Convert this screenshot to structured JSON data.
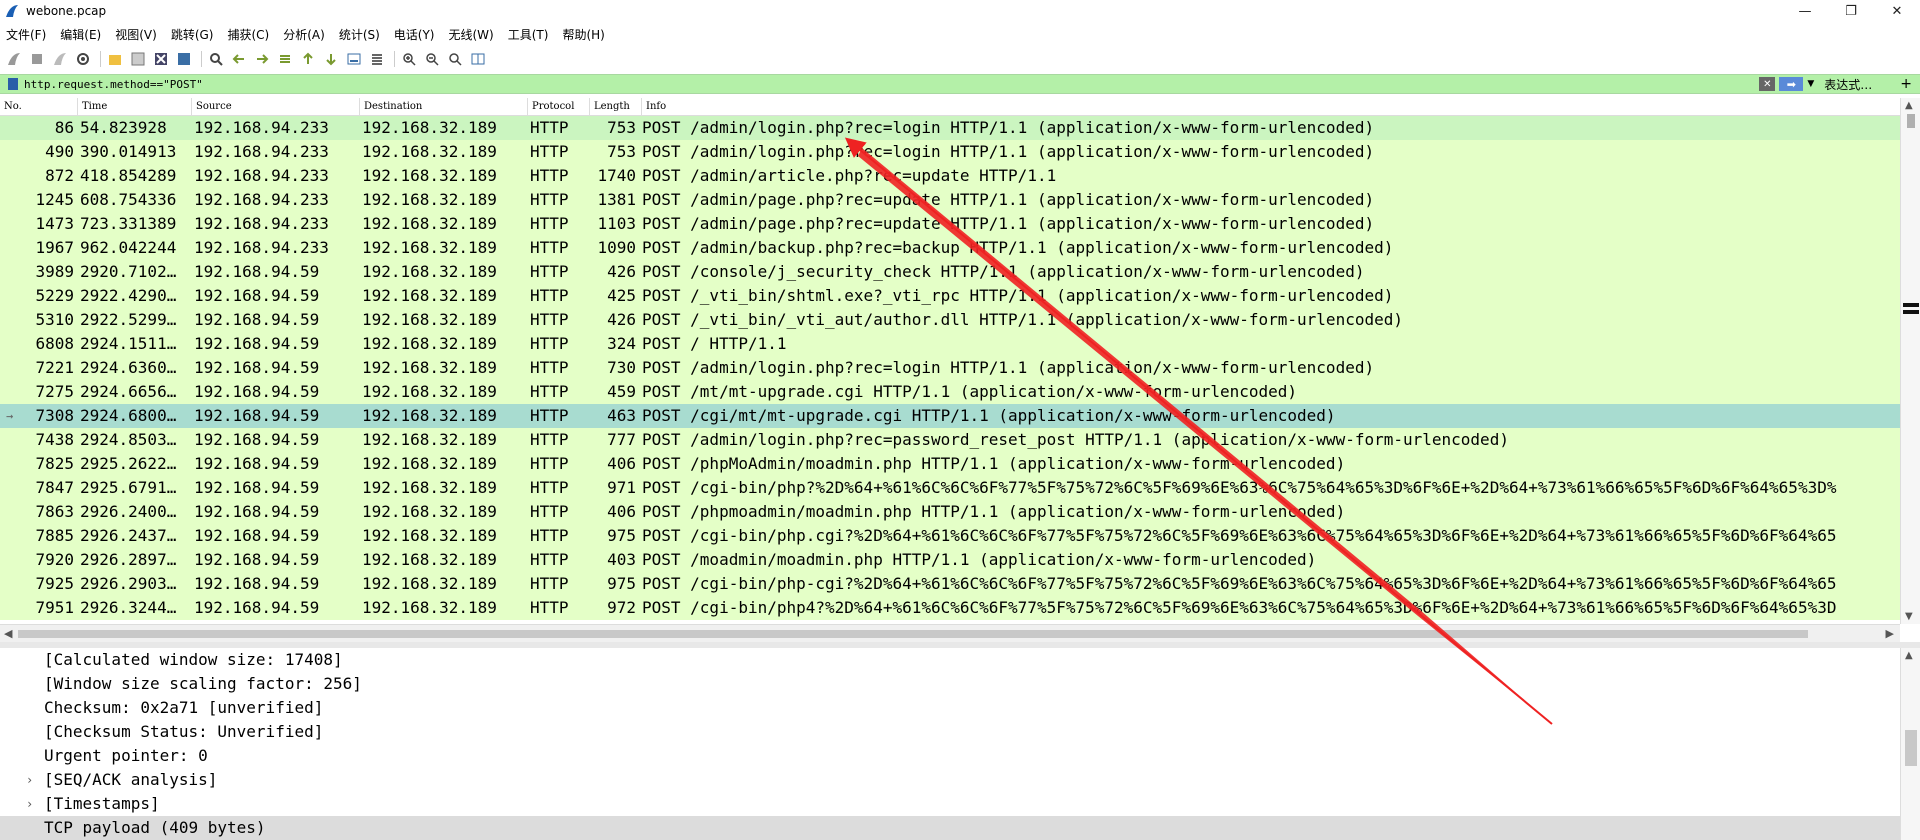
{
  "window": {
    "title": "webone.pcap",
    "controls": {
      "minimize": "—",
      "maximize": "❐",
      "close": "✕"
    }
  },
  "menu": [
    "文件(F)",
    "编辑(E)",
    "视图(V)",
    "跳转(G)",
    "捕获(C)",
    "分析(A)",
    "统计(S)",
    "电话(Y)",
    "无线(W)",
    "工具(T)",
    "帮助(H)"
  ],
  "toolbar": {
    "icons": [
      "shark-start-icon",
      "stop-icon",
      "restart-icon",
      "options-icon",
      "open-icon",
      "save-icon",
      "close-file-icon",
      "reload-icon",
      "find-icon",
      "back-icon",
      "forward-icon",
      "goto-icon",
      "first-icon",
      "last-icon",
      "autoscroll-icon",
      "colorize-icon",
      "zoom-in-icon",
      "zoom-out-icon",
      "zoom-reset-icon",
      "resize-columns-icon"
    ]
  },
  "filter": {
    "value": "http.request.method==\"POST\"",
    "expression_label": "表达式…",
    "add_label": "+"
  },
  "columns": [
    "No.",
    "Time",
    "Source",
    "Destination",
    "Protocol",
    "Length",
    "Info"
  ],
  "packets": [
    {
      "no": "86",
      "time": "54.823928",
      "src": "192.168.94.233",
      "dst": "192.168.32.189",
      "proto": "HTTP",
      "len": "753",
      "info": "POST /admin/login.php?rec=login HTTP/1.1  (application/x-www-form-urlencoded)"
    },
    {
      "no": "490",
      "time": "390.014913",
      "src": "192.168.94.233",
      "dst": "192.168.32.189",
      "proto": "HTTP",
      "len": "753",
      "info": "POST /admin/login.php?rec=login HTTP/1.1  (application/x-www-form-urlencoded)"
    },
    {
      "no": "872",
      "time": "418.854289",
      "src": "192.168.94.233",
      "dst": "192.168.32.189",
      "proto": "HTTP",
      "len": "1740",
      "info": "POST /admin/article.php?rec=update HTTP/1.1"
    },
    {
      "no": "1245",
      "time": "608.754336",
      "src": "192.168.94.233",
      "dst": "192.168.32.189",
      "proto": "HTTP",
      "len": "1381",
      "info": "POST /admin/page.php?rec=update HTTP/1.1  (application/x-www-form-urlencoded)"
    },
    {
      "no": "1473",
      "time": "723.331389",
      "src": "192.168.94.233",
      "dst": "192.168.32.189",
      "proto": "HTTP",
      "len": "1103",
      "info": "POST /admin/page.php?rec=update HTTP/1.1  (application/x-www-form-urlencoded)"
    },
    {
      "no": "1967",
      "time": "962.042244",
      "src": "192.168.94.233",
      "dst": "192.168.32.189",
      "proto": "HTTP",
      "len": "1090",
      "info": "POST /admin/backup.php?rec=backup HTTP/1.1  (application/x-www-form-urlencoded)"
    },
    {
      "no": "3989",
      "time": "2920.7102…",
      "src": "192.168.94.59",
      "dst": "192.168.32.189",
      "proto": "HTTP",
      "len": "426",
      "info": "POST /console/j_security_check HTTP/1.1  (application/x-www-form-urlencoded)"
    },
    {
      "no": "5229",
      "time": "2922.4290…",
      "src": "192.168.94.59",
      "dst": "192.168.32.189",
      "proto": "HTTP",
      "len": "425",
      "info": "POST /_vti_bin/shtml.exe?_vti_rpc HTTP/1.1  (application/x-www-form-urlencoded)"
    },
    {
      "no": "5310",
      "time": "2922.5299…",
      "src": "192.168.94.59",
      "dst": "192.168.32.189",
      "proto": "HTTP",
      "len": "426",
      "info": "POST /_vti_bin/_vti_aut/author.dll HTTP/1.1  (application/x-www-form-urlencoded)"
    },
    {
      "no": "6808",
      "time": "2924.1511…",
      "src": "192.168.94.59",
      "dst": "192.168.32.189",
      "proto": "HTTP",
      "len": "324",
      "info": "POST / HTTP/1.1"
    },
    {
      "no": "7221",
      "time": "2924.6360…",
      "src": "192.168.94.59",
      "dst": "192.168.32.189",
      "proto": "HTTP",
      "len": "730",
      "info": "POST /admin/login.php?rec=login HTTP/1.1  (application/x-www-form-urlencoded)"
    },
    {
      "no": "7275",
      "time": "2924.6656…",
      "src": "192.168.94.59",
      "dst": "192.168.32.189",
      "proto": "HTTP",
      "len": "459",
      "info": "POST /mt/mt-upgrade.cgi HTTP/1.1  (application/x-www-form-urlencoded)"
    },
    {
      "no": "7308",
      "time": "2924.6800…",
      "src": "192.168.94.59",
      "dst": "192.168.32.189",
      "proto": "HTTP",
      "len": "463",
      "info": "POST /cgi/mt/mt-upgrade.cgi HTTP/1.1  (application/x-www-form-urlencoded)"
    },
    {
      "no": "7438",
      "time": "2924.8503…",
      "src": "192.168.94.59",
      "dst": "192.168.32.189",
      "proto": "HTTP",
      "len": "777",
      "info": "POST /admin/login.php?rec=password_reset_post HTTP/1.1  (application/x-www-form-urlencoded)"
    },
    {
      "no": "7825",
      "time": "2925.2622…",
      "src": "192.168.94.59",
      "dst": "192.168.32.189",
      "proto": "HTTP",
      "len": "406",
      "info": "POST /phpMoAdmin/moadmin.php HTTP/1.1  (application/x-www-form-urlencoded)"
    },
    {
      "no": "7847",
      "time": "2925.6791…",
      "src": "192.168.94.59",
      "dst": "192.168.32.189",
      "proto": "HTTP",
      "len": "971",
      "info": "POST /cgi-bin/php?%2D%64+%61%6C%6C%6F%77%5F%75%72%6C%5F%69%6E%63%6C%75%64%65%3D%6F%6E+%2D%64+%73%61%66%65%5F%6D%6F%64%65%3D%"
    },
    {
      "no": "7863",
      "time": "2926.2400…",
      "src": "192.168.94.59",
      "dst": "192.168.32.189",
      "proto": "HTTP",
      "len": "406",
      "info": "POST /phpmoadmin/moadmin.php HTTP/1.1  (application/x-www-form-urlencoded)"
    },
    {
      "no": "7885",
      "time": "2926.2437…",
      "src": "192.168.94.59",
      "dst": "192.168.32.189",
      "proto": "HTTP",
      "len": "975",
      "info": "POST /cgi-bin/php.cgi?%2D%64+%61%6C%6C%6F%77%5F%75%72%6C%5F%69%6E%63%6C%75%64%65%3D%6F%6E+%2D%64+%73%61%66%65%5F%6D%6F%64%65"
    },
    {
      "no": "7920",
      "time": "2926.2897…",
      "src": "192.168.94.59",
      "dst": "192.168.32.189",
      "proto": "HTTP",
      "len": "403",
      "info": "POST /moadmin/moadmin.php HTTP/1.1  (application/x-www-form-urlencoded)"
    },
    {
      "no": "7925",
      "time": "2926.2903…",
      "src": "192.168.94.59",
      "dst": "192.168.32.189",
      "proto": "HTTP",
      "len": "975",
      "info": "POST /cgi-bin/php-cgi?%2D%64+%61%6C%6C%6F%77%5F%75%72%6C%5F%69%6E%63%6C%75%64%65%3D%6F%6E+%2D%64+%73%61%66%65%5F%6D%6F%64%65"
    },
    {
      "no": "7951",
      "time": "2926.3244…",
      "src": "192.168.94.59",
      "dst": "192.168.32.189",
      "proto": "HTTP",
      "len": "972",
      "info": "POST /cgi-bin/php4?%2D%64+%61%6C%6C%6F%77%5F%75%72%6C%5F%69%6E%63%6C%75%64%65%3D%6F%6E+%2D%64+%73%61%66%65%5F%6D%6F%64%65%3D"
    }
  ],
  "details": [
    {
      "text": "[Calculated window size: 17408]",
      "expandable": false
    },
    {
      "text": "[Window size scaling factor: 256]",
      "expandable": false
    },
    {
      "text": "Checksum: 0x2a71 [unverified]",
      "expandable": false
    },
    {
      "text": "[Checksum Status: Unverified]",
      "expandable": false
    },
    {
      "text": "Urgent pointer: 0",
      "expandable": false
    },
    {
      "text": "[SEQ/ACK analysis]",
      "expandable": true
    },
    {
      "text": "[Timestamps]",
      "expandable": true
    },
    {
      "text": "TCP payload (409 bytes)",
      "expandable": false
    }
  ],
  "colors": {
    "row_bg": "#e4ffc7",
    "row_highlight": "#a8dcd0",
    "filter_bg": "#b4f0a8",
    "annotation_arrow": "#ee2222"
  }
}
